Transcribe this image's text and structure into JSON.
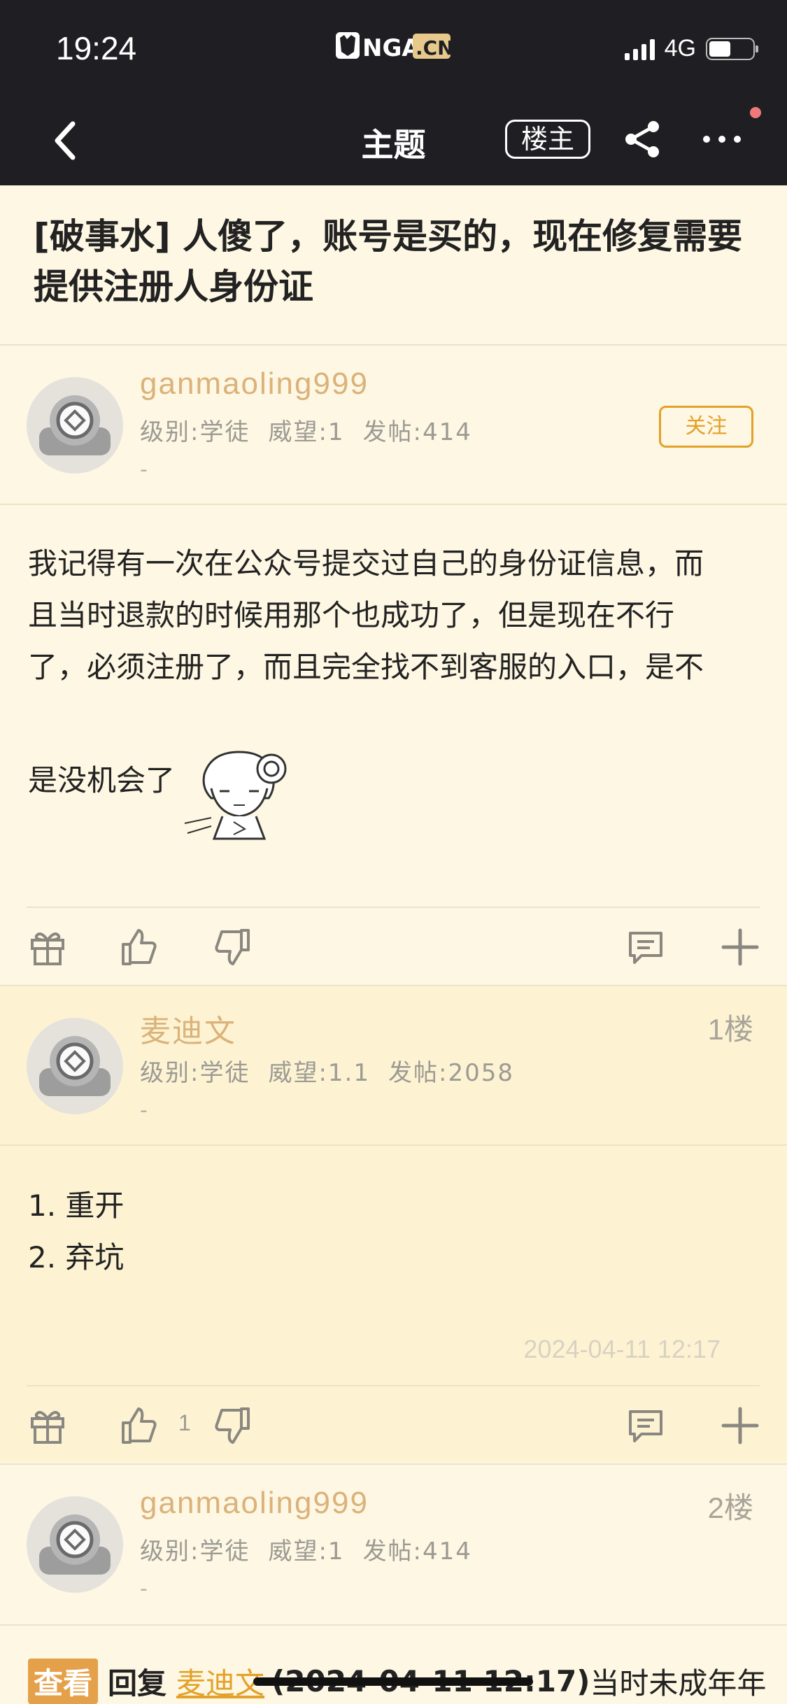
{
  "status": {
    "time": "19:24",
    "network": "4G",
    "logo": "NGA.CN"
  },
  "nav": {
    "title": "主题",
    "op_label": "楼主"
  },
  "topic": {
    "title": "[破事水] 人傻了，账号是买的，现在修复需要提供注册人身份证"
  },
  "posts": [
    {
      "username": "ganmaoling999",
      "level": "级别:学徒",
      "prestige": "威望:1",
      "posts": "发帖:414",
      "sig": "-",
      "follow_label": "关注",
      "lines": [
        "我记得有一次在公众号提交过自己的身份证信息，而",
        "且当时退款的时候用那个也成功了，但是现在不行",
        "了，必须注册了，而且完全找不到客服的入口，是不",
        "是没机会了"
      ]
    },
    {
      "username": "麦迪文",
      "floor": "1楼",
      "level": "级别:学徒",
      "prestige": "威望:1.1",
      "posts": "发帖:2058",
      "sig": "-",
      "lines": [
        "1. 重开",
        "2. 弃坑"
      ],
      "timestamp": "2024-04-11 12:17",
      "like_count": "1"
    },
    {
      "username": "ganmaoling999",
      "floor": "2楼",
      "level": "级别:学徒",
      "prestige": "威望:1",
      "posts": "发帖:414",
      "sig": "-",
      "quote": {
        "tag": "查看",
        "reply": "回复",
        "user": "麦迪文",
        "time": "(2024-04-11 12:17)",
        "rest": "当时未成年年"
      }
    }
  ]
}
